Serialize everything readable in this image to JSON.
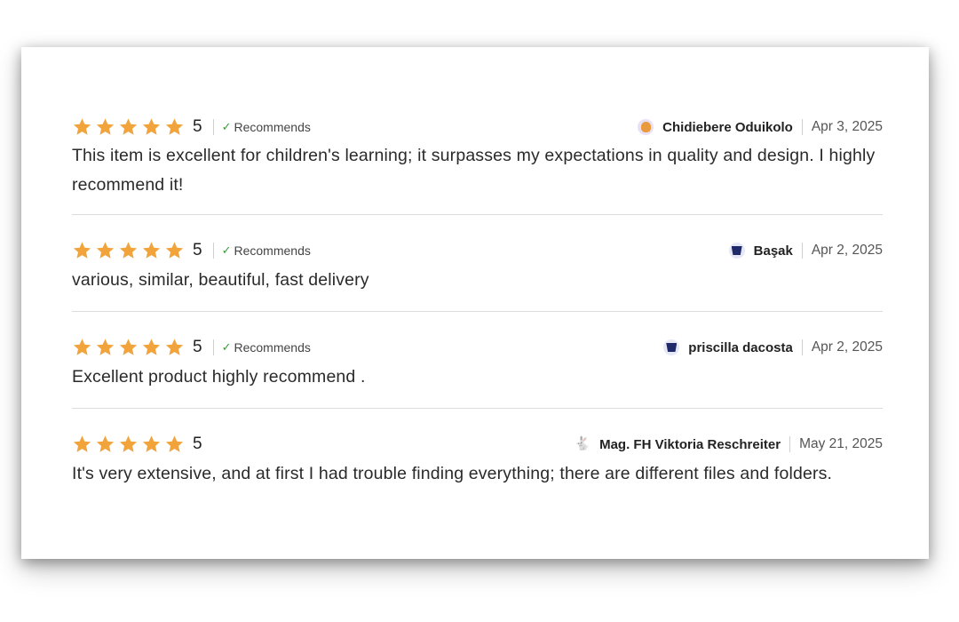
{
  "reviews": [
    {
      "rating": "5",
      "stars": 5,
      "recommends": "Recommends",
      "avatar_icon": "orange-blob-avatar",
      "reviewer": "Chidiebere Oduikolo",
      "date": "Apr 3, 2025",
      "text": "This item is excellent for children's learning; it surpasses my expectations in quality and design. I highly recommend it!"
    },
    {
      "rating": "5",
      "stars": 5,
      "recommends": "Recommends",
      "avatar_icon": "navy-cup-avatar",
      "reviewer": "Başak",
      "date": "Apr 2, 2025",
      "text": "various, similar, beautiful, fast delivery"
    },
    {
      "rating": "5",
      "stars": 5,
      "recommends": "Recommends",
      "avatar_icon": "navy-cup-avatar",
      "reviewer": "priscilla dacosta",
      "date": "Apr 2, 2025",
      "text": "Excellent product highly recommend ."
    },
    {
      "rating": "5",
      "stars": 5,
      "recommends": "",
      "avatar_icon": "bunny-avatar",
      "reviewer": "Mag. FH Viktoria Reschreiter",
      "date": "May 21, 2025",
      "text": "It's very extensive, and at first I had trouble finding everything; there are different files and folders."
    }
  ],
  "colors": {
    "star": "#F1A33C",
    "check": "#3A9A3A",
    "divider": "#DCDCDC"
  }
}
